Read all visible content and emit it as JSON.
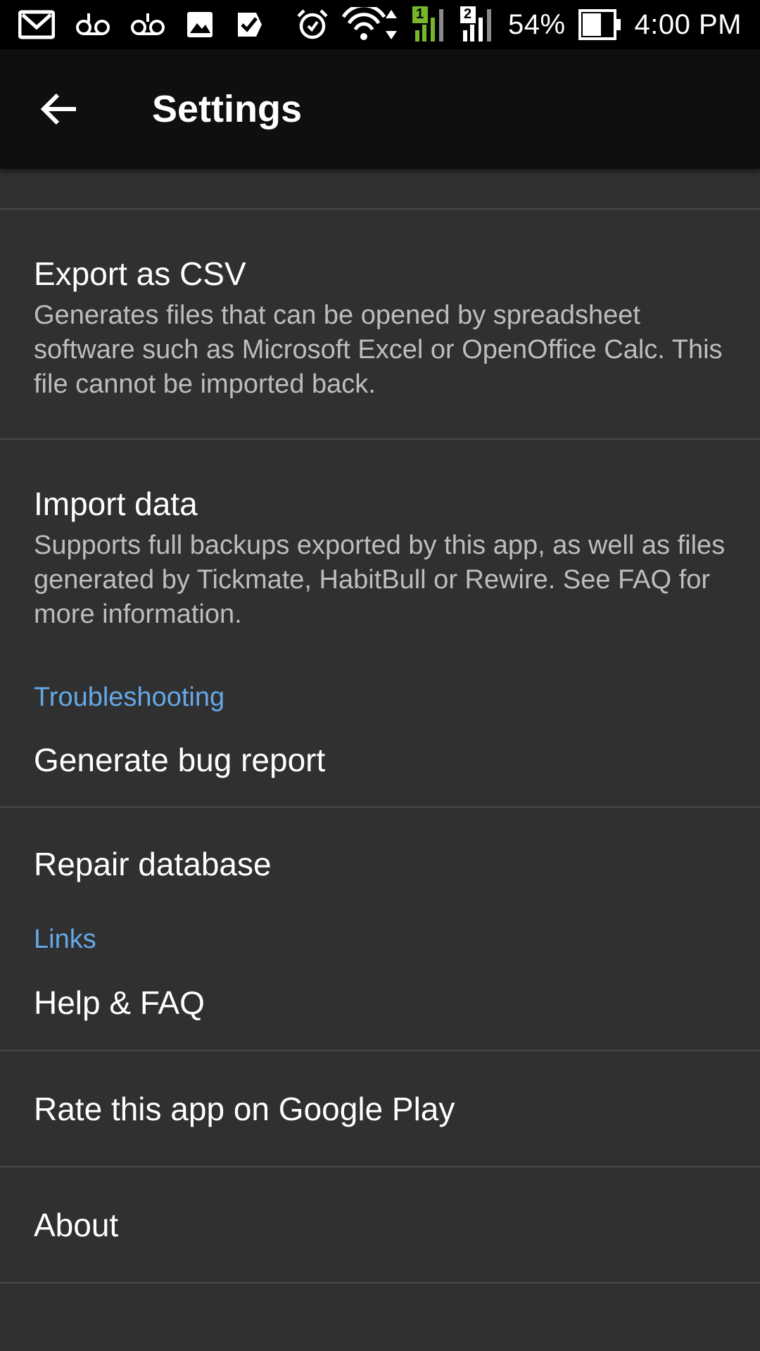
{
  "status_bar": {
    "notification_icons": [
      "gmail-icon",
      "voicemail-icon",
      "voicemail-icon",
      "image-icon",
      "tasks-check-icon"
    ],
    "status_icons": [
      "alarm-icon",
      "wifi-icon",
      "signal-sim1-icon",
      "signal-sim2-icon",
      "battery-icon"
    ],
    "sim1_label": "1",
    "sim2_label": "2",
    "battery": "54%",
    "time": "4:00 PM"
  },
  "app_bar": {
    "back_icon": "arrow-back-icon",
    "title": "Settings"
  },
  "list": {
    "export_csv": {
      "title": "Export as CSV",
      "summary": "Generates files that can be opened by spreadsheet software such as Microsoft Excel or OpenOffice Calc. This file cannot be imported back."
    },
    "import_data": {
      "title": "Import data",
      "summary": "Supports full backups exported by this app, as well as files generated by Tickmate, HabitBull or Rewire. See FAQ for more information."
    },
    "troubleshooting_header": "Troubleshooting",
    "generate_bug_report": "Generate bug report",
    "repair_database": "Repair database",
    "links_header": "Links",
    "help_faq": "Help & FAQ",
    "rate_app": "Rate this app on Google Play",
    "about": "About"
  },
  "colors": {
    "background": "#303030",
    "app_bar": "#0f0f0f",
    "accent": "#64a8e8",
    "summary_text": "#bdbdbd",
    "signal_green": "#76b82a"
  }
}
